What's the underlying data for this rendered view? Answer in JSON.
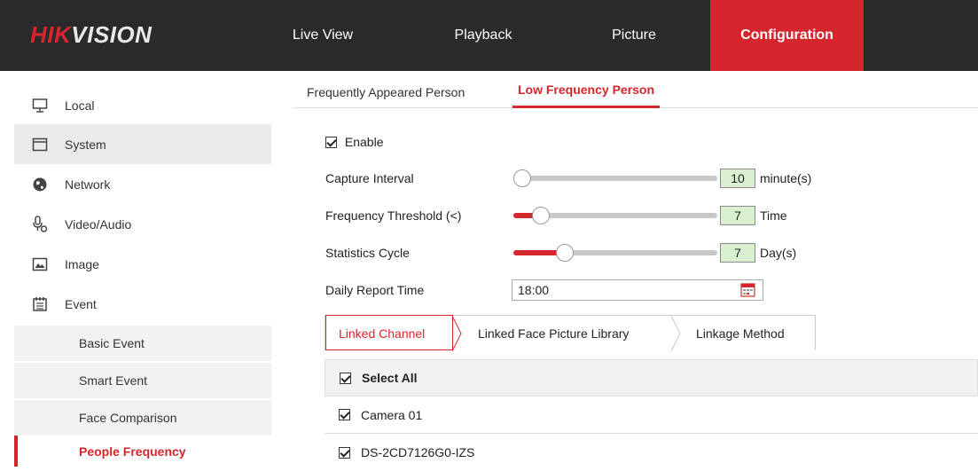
{
  "header": {
    "logo_red": "HIK",
    "logo_rest": "VISION",
    "tabs": [
      {
        "label": "Live View"
      },
      {
        "label": "Playback"
      },
      {
        "label": "Picture"
      },
      {
        "label": "Configuration"
      }
    ],
    "active_tab": "Configuration"
  },
  "sidebar": {
    "items": [
      {
        "label": "Local",
        "icon": "monitor-icon"
      },
      {
        "label": "System",
        "icon": "window-icon"
      },
      {
        "label": "Network",
        "icon": "globe-icon"
      },
      {
        "label": "Video/Audio",
        "icon": "microphone-icon"
      },
      {
        "label": "Image",
        "icon": "image-icon"
      },
      {
        "label": "Event",
        "icon": "calendar-icon"
      }
    ],
    "sub_items": [
      {
        "label": "Basic Event"
      },
      {
        "label": "Smart Event"
      },
      {
        "label": "Face Comparison"
      },
      {
        "label": "People Frequency"
      }
    ],
    "active": "People Frequency"
  },
  "subtabs": [
    {
      "label": "Frequently Appeared Person"
    },
    {
      "label": "Low Frequency Person"
    }
  ],
  "active_subtab": "Low Frequency Person",
  "form": {
    "enable_label": "Enable",
    "enable_checked": true,
    "capture_interval": {
      "label": "Capture Interval",
      "value": "10",
      "unit": "minute(s)",
      "fill_fraction": 0.0
    },
    "frequency_threshold": {
      "label": "Frequency Threshold (<)",
      "value": "7",
      "unit": "Time",
      "fill_fraction": 0.1
    },
    "statistics_cycle": {
      "label": "Statistics Cycle",
      "value": "7",
      "unit": "Day(s)",
      "fill_fraction": 0.23
    },
    "daily_report": {
      "label": "Daily Report Time",
      "value": "18:00"
    }
  },
  "linkage_tabs": [
    {
      "label": "Linked Channel"
    },
    {
      "label": "Linked Face Picture Library"
    },
    {
      "label": "Linkage Method"
    }
  ],
  "active_linkage_tab": "Linked Channel",
  "channels": {
    "select_all_label": "Select All",
    "rows": [
      {
        "label": "Camera 01",
        "checked": true
      },
      {
        "label": "DS-2CD7126G0-IZS",
        "checked": true
      }
    ]
  },
  "colors": {
    "accent": "#d6262d",
    "topbar": "#2a2a2a",
    "value_box": "#d8f0d0"
  }
}
